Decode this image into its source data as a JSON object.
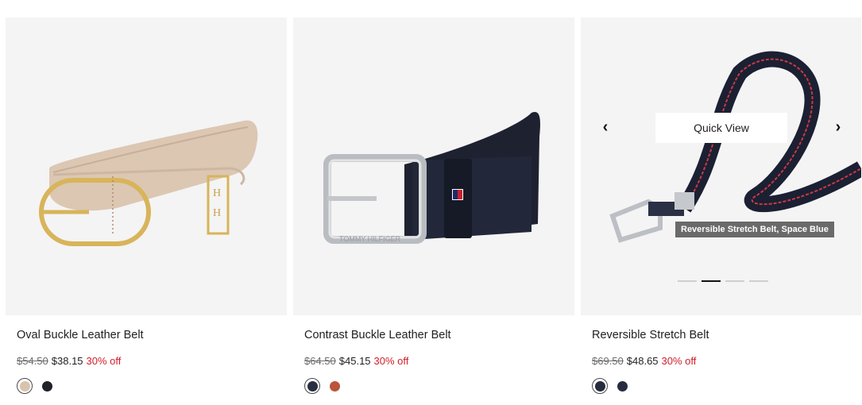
{
  "products": [
    {
      "title": "Oval Buckle Leather Belt",
      "old_price": "$54.50",
      "new_price": "$38.15",
      "discount": "30% off",
      "swatches": [
        {
          "color": "#d9c3ad",
          "selected": true
        },
        {
          "color": "#1f2228",
          "selected": false
        }
      ]
    },
    {
      "title": "Contrast Buckle Leather Belt",
      "old_price": "$64.50",
      "new_price": "$45.15",
      "discount": "30% off",
      "swatches": [
        {
          "color": "#2a3040",
          "selected": true
        },
        {
          "color": "#b8553a",
          "selected": false
        }
      ]
    },
    {
      "title": "Reversible Stretch Belt",
      "old_price": "$69.50",
      "new_price": "$48.65",
      "discount": "30% off",
      "swatches": [
        {
          "color": "#272c3f",
          "selected": true
        },
        {
          "color": "#262c40",
          "selected": false
        }
      ],
      "quick_view_label": "Quick View",
      "tooltip": "Reversible Stretch Belt, Space Blue",
      "carousel": {
        "slide_count": 4,
        "active_index": 1
      }
    }
  ],
  "icons": {
    "prev": "chevron-left-icon",
    "next": "chevron-right-icon"
  },
  "colors": {
    "discount": "#d01f2a",
    "image_bg": "#f4f4f4"
  }
}
